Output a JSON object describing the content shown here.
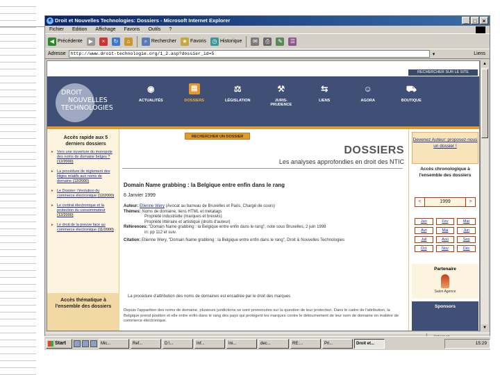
{
  "browser": {
    "title": "Droit et Nouvelles Technologies: Dossiers - Microsoft Internet Explorer",
    "menu": [
      "Fichier",
      "Edition",
      "Affichage",
      "Favoris",
      "Outils",
      "?"
    ],
    "toolbar": {
      "back": "Précédente",
      "forward": "",
      "search": "Rechercher",
      "favorites": "Favoris",
      "history": "Historique"
    },
    "address_label": "Adresse",
    "address_value": "http://www.droit-technologie.org/1_2.asp?dossier_id=5",
    "links_label": "Liens",
    "status_left": "",
    "status_right": "Internet"
  },
  "site": {
    "top_search": "RECHERCHER SUR LE SITE",
    "logo_lines": [
      "DROIT",
      "NOUVELLES",
      "TECHNOLOGIES"
    ],
    "nav": [
      {
        "label": "ACTUALITÉS",
        "icon": "antenna-icon"
      },
      {
        "label": "DOSSIERS",
        "icon": "folder-icon"
      },
      {
        "label": "LÉGISLATION",
        "icon": "gavel-icon"
      },
      {
        "label": "JURIS-\nPRUDENCE",
        "icon": "hammer-icon"
      },
      {
        "label": "LIENS",
        "icon": "links-icon"
      },
      {
        "label": "AGORA",
        "icon": "people-icon"
      },
      {
        "label": "BOUTIQUE",
        "icon": "cart-icon"
      }
    ],
    "search_dossier": "RECHERCHER UN DOSSIER"
  },
  "left": {
    "heading": "Accès rapide aux 5 derniers dossiers",
    "items": [
      {
        "text": "Vers une ouverture du monopole des noms de domaine belges ?",
        "date": "(12/2000)"
      },
      {
        "text": "La procédure de règlement des litiges relatifs aux noms de domaine",
        "date": "(12/2000)"
      },
      {
        "text": "Le Dossier: l'évolution du commerce électronique",
        "date": "(12/2000)"
      },
      {
        "text": "Le contrat électronique et la protection du consommateur",
        "date": "(12/2000)"
      },
      {
        "text": "Le droit de la preuve face au commerce électronique",
        "date": "(11/2000)"
      }
    ],
    "thematic": "Accès thématique à l'ensemble des dossiers"
  },
  "center": {
    "title": "DOSSIERS",
    "subtitle": "Les analyses approfondies en droit des NTIC",
    "article_title": "Domain Name grabbing : la Belgique entre enfin dans le rang",
    "article_date": "6 Janvier 1999",
    "author_label": "Auteur:",
    "author_name": "Etienne Wery",
    "author_detail": "(Avocat au barreau de Bruxelles et Paris, Chargé de cours)",
    "themes_label": "Thèmes:",
    "themes": [
      "Noms de domaine, liens HTML et metatags",
      "Propriété industrielle (marques et brevets)",
      "Propriété littéraire et artistique (droits d'auteur)"
    ],
    "refs_label": "Références:",
    "refs": "\"Domain Name grabbing : la Belgique entre enfin dans le rang\", note sous Bruxelles, 2 juin 1998",
    "refs2": "in: pp 112 et suiv.",
    "citation_label": "Citation:",
    "citation": "Etienne Wery, \"Domain Name grabbing : la Belgique entre enfin dans le rang\", Droit & Nouvelles Technologies",
    "intro": "La procédure d'attribution des noms de domaines est encadrée par le droit des marques",
    "body": "Depuis l'apparition des noms de domaine, plusieurs juridictions se sont prononcées sur la question de leur protection. Dans le cadre de l'attribution, la Belgique prend position et elle entre enfin dans le rang des pays qui protègent les marques contre le détournement de leur nom de domaine en matière de commerce électronique."
  },
  "right": {
    "devenez": "Devenez Auteur: proposez-nous un dossier !",
    "chrono": "Accès chronologique à l'ensemble des dossiers",
    "year_prev": "<",
    "year": "1999",
    "year_next": ">",
    "months": [
      "Jan",
      "Fév",
      "Mar",
      "Avr",
      "Mai",
      "Jun",
      "Juil",
      "Aoû",
      "Sep",
      "Oct",
      "Nov",
      "Déc"
    ],
    "partenaire": "Partenaire",
    "partenaire_sub": "Salon Agence",
    "sponsors": "Sponsors"
  },
  "taskbar": {
    "start": "Start",
    "tasks": [
      "Mic...",
      "Ref...",
      "D:\\...",
      "Inf...",
      "Ini...",
      "dec...",
      "RE:...",
      "Pri...",
      "Droit et..."
    ],
    "clock": "15:29"
  }
}
